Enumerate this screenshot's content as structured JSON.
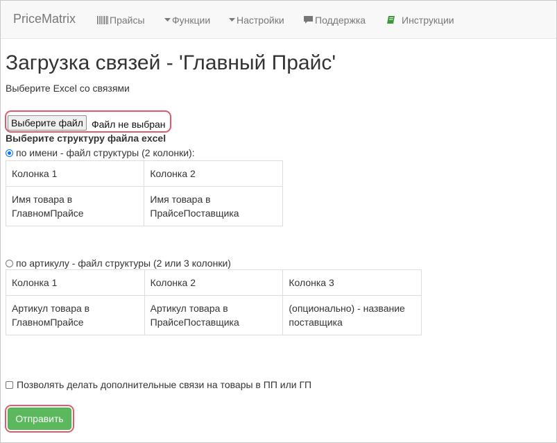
{
  "navbar": {
    "brand": "PriceMatrix",
    "items": [
      {
        "label": "Прайсы",
        "icon": "barcode-icon"
      },
      {
        "label": "Функции",
        "icon": "caret-down-icon"
      },
      {
        "label": "Настройки",
        "icon": "caret-down-icon"
      },
      {
        "label": "Поддержка",
        "icon": "comment-icon"
      },
      {
        "label": "Инструкции",
        "icon": "book-icon"
      }
    ]
  },
  "page": {
    "title": "Загрузка связей - 'Главный Прайс'",
    "subtitle": "Выберите Excel со связями"
  },
  "file_input": {
    "button_label": "Выберите файл",
    "status": "Файл не выбран"
  },
  "structure": {
    "label": "Выберите структуру файла excel",
    "by_name": {
      "label": "по имени - файл структуры (2 колонки):",
      "checked": true,
      "header": [
        "Колонка 1",
        "Колонка 2"
      ],
      "row": [
        "Имя товара в ГлавномПрайсе",
        "Имя товара в ПрайсеПоставщика"
      ]
    },
    "by_article": {
      "label": "по артикулу - файл структуры (2 или 3 колонки)",
      "checked": false,
      "header": [
        "Колонка 1",
        "Колонка 2",
        "Колонка 3"
      ],
      "row": [
        "Артикул товара в ГлавномПрайсе",
        "Артикул товара в ПрайсеПоставщика",
        "(опционально) - название поставщика"
      ]
    }
  },
  "extra_links": {
    "label": "Позволять делать дополнительные связи на товары в ПП или ГП",
    "checked": false
  },
  "submit": {
    "label": "Отправить"
  },
  "colors": {
    "accent_green": "#5cb85c",
    "highlight_red": "#e05a6a",
    "radio_blue": "#0075ff",
    "nav_text": "#777777",
    "book_icon_green": "#3c9a3c"
  }
}
